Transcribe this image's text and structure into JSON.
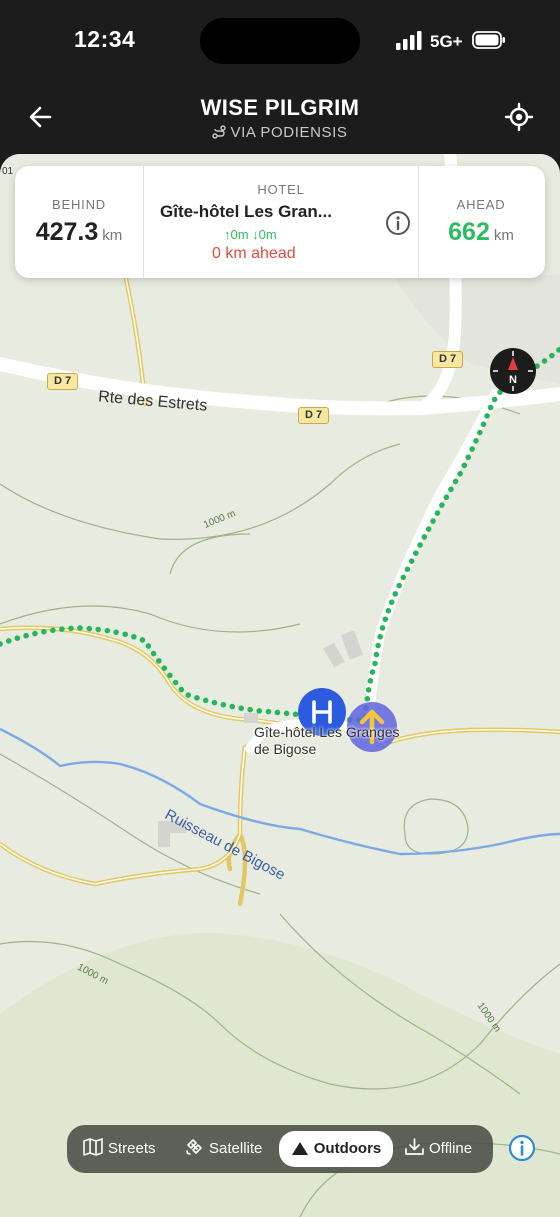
{
  "status": {
    "time": "12:34",
    "network": "5G+"
  },
  "header": {
    "title": "WISE PILGRIM",
    "subtitle": "VIA PODIENSIS",
    "back_icon": "arrow-left-icon",
    "locate_icon": "crosshair-icon"
  },
  "card": {
    "behind_label": "BEHIND",
    "behind_value": "427.3",
    "behind_unit": "km",
    "hotel_label": "HOTEL",
    "hotel_name": "Gîte-hôtel Les Gran...",
    "hotel_elev": "↑0m ↓0m",
    "hotel_dist": "0 km ahead",
    "ahead_label": "AHEAD",
    "ahead_value": "662",
    "ahead_unit": "km"
  },
  "map": {
    "road_name": "Rte des Estrets",
    "road_ref": "D 7",
    "stream_name": "Ruisseau de Bigose",
    "contour": "1000 m",
    "place_name": "Gîte-hôtel Les Granges de Bigose",
    "edge_label": "01"
  },
  "layers": {
    "streets": "Streets",
    "satellite": "Satellite",
    "outdoors": "Outdoors",
    "offline": "Offline",
    "selected": "Outdoors"
  },
  "colors": {
    "route": "#25b55a",
    "accent_green": "#2dbd5f",
    "distance_red": "#e24a3b",
    "info_blue": "#2a8bd8",
    "hotel_marker": "#2d5be0"
  }
}
